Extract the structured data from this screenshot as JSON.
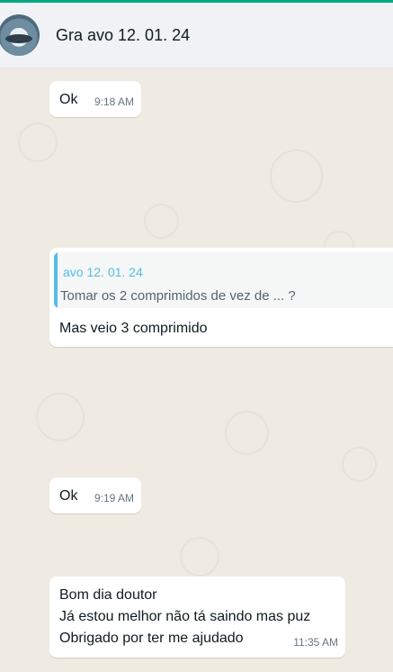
{
  "chat": {
    "contact_name": "Gra avo 12. 01. 24"
  },
  "messages": [
    {
      "text": "Ok",
      "time": "9:18 AM"
    },
    {
      "quote_author": "avo 12. 01. 24",
      "quote_text": "Tomar os 2 comprimidos de vez de ... ?",
      "text": "Mas veio 3 comprimido"
    },
    {
      "text": "Ok",
      "time": "9:19 AM"
    },
    {
      "lines": [
        "Bom dia doutor",
        "Já estou melhor não tá saindo mas puz",
        "Obrigado por ter me ajudado"
      ],
      "time": "11:35 AM"
    }
  ],
  "colors": {
    "accent": "#00a884",
    "quote_accent": "#53bdeb",
    "chat_background": "#efeae2",
    "bubble": "#ffffff"
  }
}
